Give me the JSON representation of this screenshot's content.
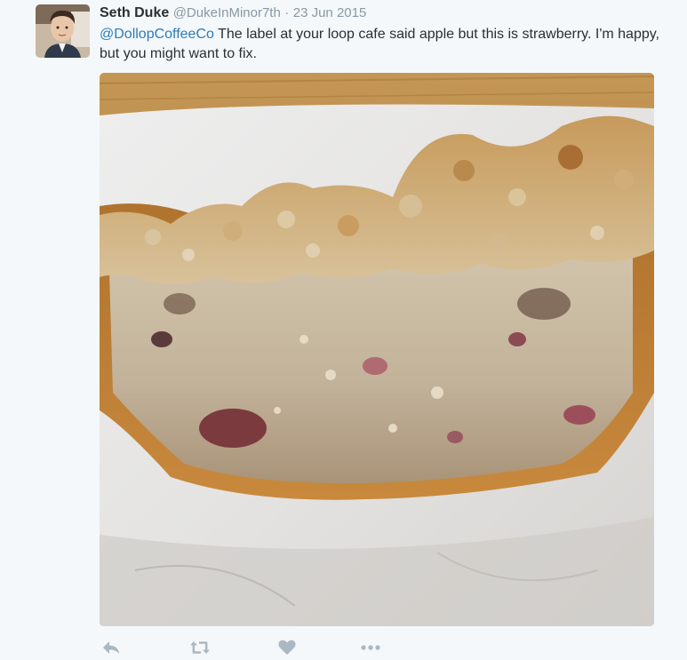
{
  "tweet": {
    "author_name": "Seth Duke",
    "author_handle": "@DukeInMinor7th",
    "separator": "·",
    "date": "23 Jun 2015",
    "mention": "@DollopCoffeeCo",
    "text_after_mention": " The label at your loop cafe said apple but this is strawberry. I'm happy, but you might want to fix."
  },
  "actions": {
    "reply_icon": "reply-icon",
    "retweet_icon": "retweet-icon",
    "like_icon": "heart-icon",
    "more_icon": "more-dots-icon"
  },
  "colors": {
    "background": "#f5f8fa",
    "text": "#292f33",
    "secondary_text": "#8899a6",
    "link": "#2b7bb9",
    "action_icon": "#aab8c2"
  }
}
